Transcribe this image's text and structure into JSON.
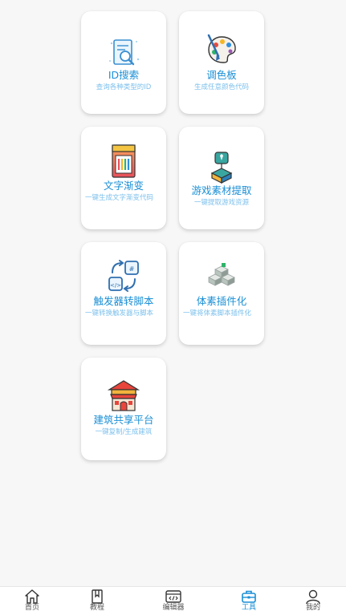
{
  "cards": [
    {
      "icon": "id-search-icon",
      "title": "ID搜索",
      "subtitle": "查询各种类型的ID"
    },
    {
      "icon": "palette-icon",
      "title": "调色板",
      "subtitle": "生成任意颜色代码"
    },
    {
      "icon": "gradient-text-icon",
      "title": "文字渐变",
      "subtitle": "一键生成文字渐变代码"
    },
    {
      "icon": "game-assets-icon",
      "title": "游戏素材提取",
      "subtitle": "一键提取游戏资源"
    },
    {
      "icon": "trigger-script-icon",
      "title": "触发器转脚本",
      "subtitle": "一键转换触发器与脚本"
    },
    {
      "icon": "voxel-plugin-icon",
      "title": "体素插件化",
      "subtitle": "一键将体素脚本插件化"
    },
    {
      "icon": "building-share-icon",
      "title": "建筑共享平台",
      "subtitle": "一键复制/生成建筑"
    }
  ],
  "tabbar": {
    "items": [
      {
        "label": "首页",
        "icon": "home-icon"
      },
      {
        "label": "教程",
        "icon": "bookmark-icon"
      },
      {
        "label": "编辑器",
        "icon": "code-editor-icon"
      },
      {
        "label": "工具",
        "icon": "toolbox-icon"
      },
      {
        "label": "我的",
        "icon": "user-icon"
      }
    ],
    "active": "工具",
    "active_color": "#1a8fd6",
    "inactive_color": "#555555"
  },
  "colors": {
    "accent": "#1a8fd6",
    "subtitle": "#7cc0ec"
  }
}
